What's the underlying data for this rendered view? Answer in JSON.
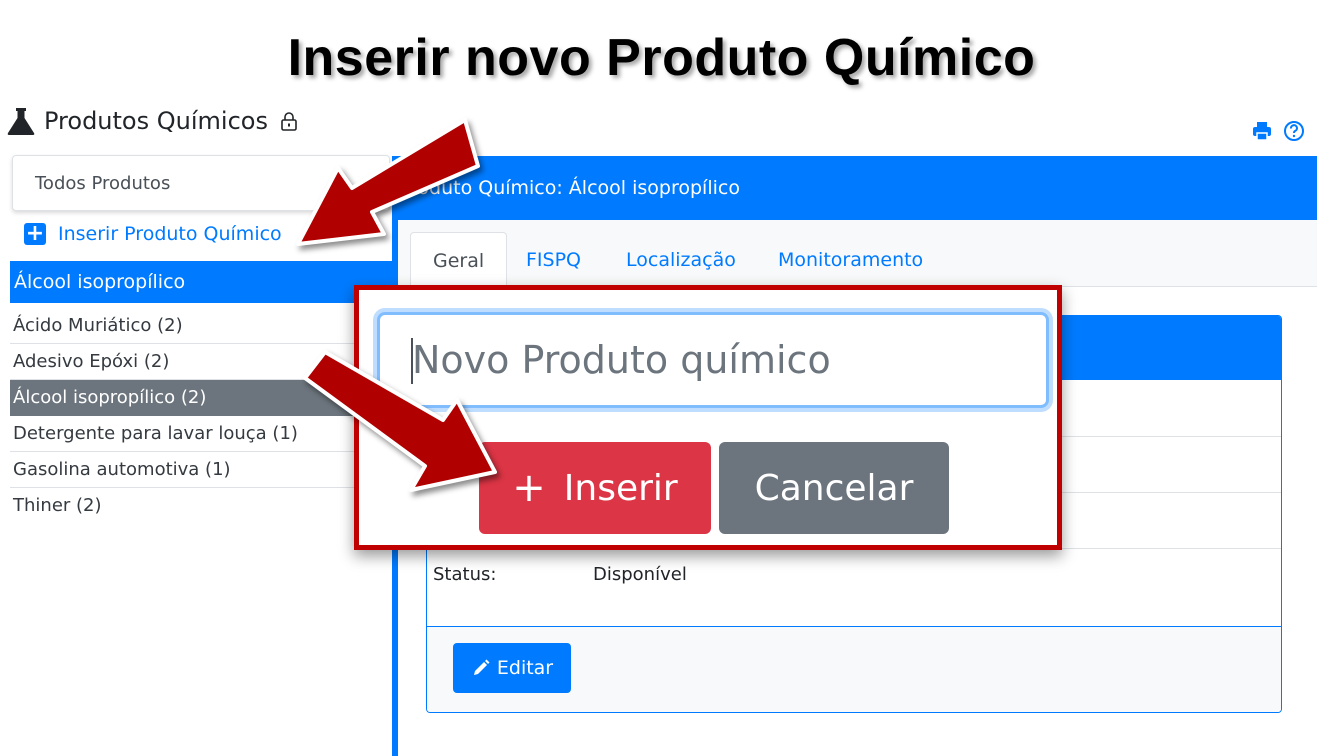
{
  "slide": {
    "title": "Inserir novo Produto Químico"
  },
  "app": {
    "title": "Produtos Químicos",
    "icons": {
      "flask": "flask-icon",
      "lock": "lock-icon",
      "print": "print-icon",
      "help": "help-icon"
    }
  },
  "sidebar": {
    "filter": "Todos Produtos",
    "insert_link": "Inserir Produto Químico",
    "active_item": "Álcool isopropílico",
    "items": [
      "Ácido Muriático (2)",
      "Adesivo Epóxi (2)",
      "Álcool isopropílico (2)",
      "Detergente para lavar louça (1)",
      "Gasolina automotiva (1)",
      "Thiner (2)"
    ]
  },
  "main": {
    "card_title": "roduto Químico: Álcool isopropílico",
    "tabs": [
      "Geral",
      "FISPQ",
      "Localização",
      "Monitoramento"
    ],
    "status_label": "Status:",
    "status_value": "Disponível",
    "edit_label": "Editar"
  },
  "modal": {
    "placeholder": "Novo Produto químico",
    "insert_label": "Inserir",
    "cancel_label": "Cancelar"
  },
  "colors": {
    "primary": "#007bff",
    "danger": "#dc3545",
    "secondary": "#6c757d",
    "highlight_border": "#c00000",
    "arrow": "#b00000"
  }
}
